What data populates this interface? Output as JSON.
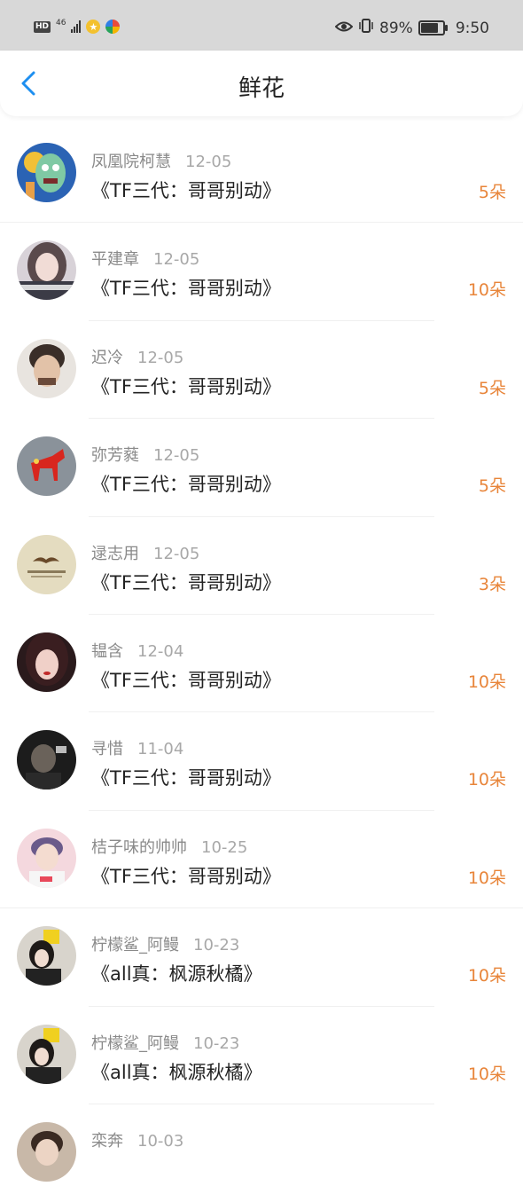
{
  "status_bar": {
    "hd": "HD",
    "signal": "46",
    "battery_percent": "89%",
    "battery_level": 0.89,
    "time": "9:50"
  },
  "header": {
    "title": "鲜花"
  },
  "rows": [
    {
      "name": "凤凰院柯慧",
      "date": "12-05",
      "book": "《TF三代：哥哥别动》",
      "count": "5朵"
    },
    {
      "name": "平建章",
      "date": "12-05",
      "book": "《TF三代：哥哥别动》",
      "count": "10朵"
    },
    {
      "name": "迟冷",
      "date": "12-05",
      "book": "《TF三代：哥哥别动》",
      "count": "5朵"
    },
    {
      "name": "弥芳蕤",
      "date": "12-05",
      "book": "《TF三代：哥哥别动》",
      "count": "5朵"
    },
    {
      "name": "逯志用",
      "date": "12-05",
      "book": "《TF三代：哥哥别动》",
      "count": "3朵"
    },
    {
      "name": "韫含",
      "date": "12-04",
      "book": "《TF三代：哥哥别动》",
      "count": "10朵"
    },
    {
      "name": "寻惜",
      "date": "11-04",
      "book": "《TF三代：哥哥别动》",
      "count": "10朵"
    },
    {
      "name": "桔子味的帅帅",
      "date": "10-25",
      "book": "《TF三代：哥哥别动》",
      "count": "10朵"
    },
    {
      "name": "柠檬鲨_阿鳗",
      "date": "10-23",
      "book": "《all真：枫源秋橘》",
      "count": "10朵"
    },
    {
      "name": "柠檬鲨_阿鳗",
      "date": "10-23",
      "book": "《all真：枫源秋橘》",
      "count": "10朵"
    },
    {
      "name": "栾奔",
      "date": "10-03",
      "book": "",
      "count": ""
    }
  ]
}
